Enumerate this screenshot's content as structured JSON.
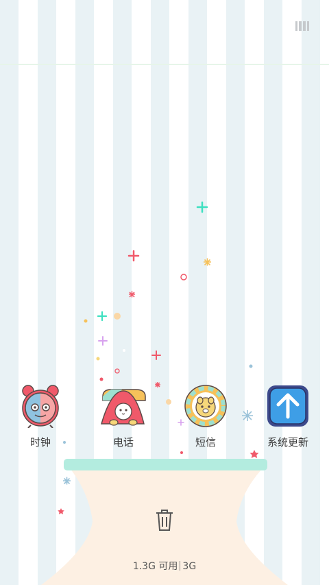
{
  "status_icon": "recent-apps-icon",
  "apps": [
    {
      "label": "时钟",
      "icon": "alarm-clock-icon"
    },
    {
      "label": "电话",
      "icon": "phone-icon"
    },
    {
      "label": "短信",
      "icon": "message-icon"
    },
    {
      "label": "系统更新",
      "icon": "system-update-icon"
    }
  ],
  "cleaner": {
    "icon": "trash-icon",
    "available": "1.3G 可用",
    "total": "3G"
  },
  "colors": {
    "stripe": "#e9f2f5",
    "rim": "#b3ecdf",
    "bowl": "#fdf0e3"
  }
}
